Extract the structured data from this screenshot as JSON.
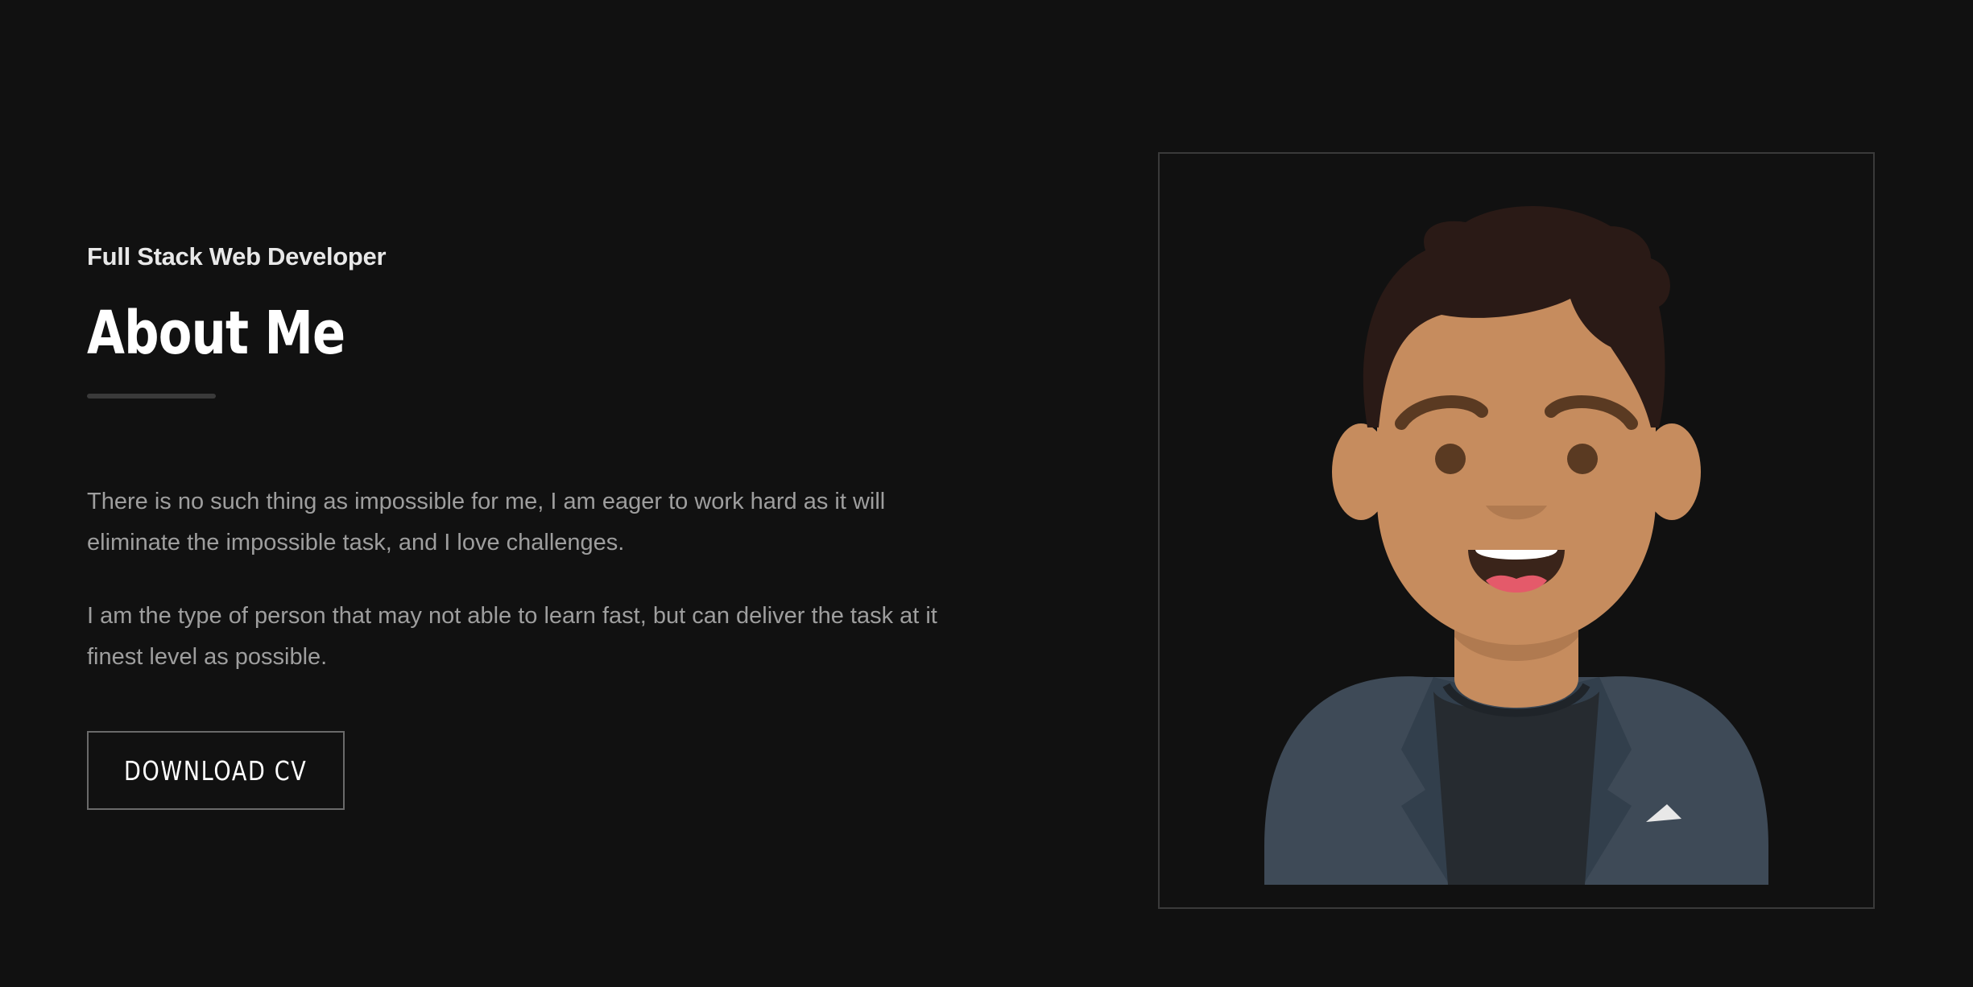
{
  "about": {
    "subtitle": "Full Stack Web Developer",
    "title": "About Me",
    "paragraphs": [
      "There is no such thing as impossible for me, I am eager to work hard as it will eliminate the impossible task, and I love challenges.",
      "I am the type of person that may not able to learn fast, but can deliver the task at it finest level as possible."
    ],
    "button_label": "DOWNLOAD CV"
  },
  "avatar": {
    "icon": "person-avatar-illustration"
  },
  "colors": {
    "background": "#111111",
    "title": "#ffffff",
    "subtitle": "#e8e8e8",
    "body_text": "#9e9e9e",
    "frame_border": "#3a3a3a",
    "skin": "#c68c5e",
    "hair": "#2a1a16",
    "jacket": "#3e4a57",
    "shirt": "#262b30"
  }
}
